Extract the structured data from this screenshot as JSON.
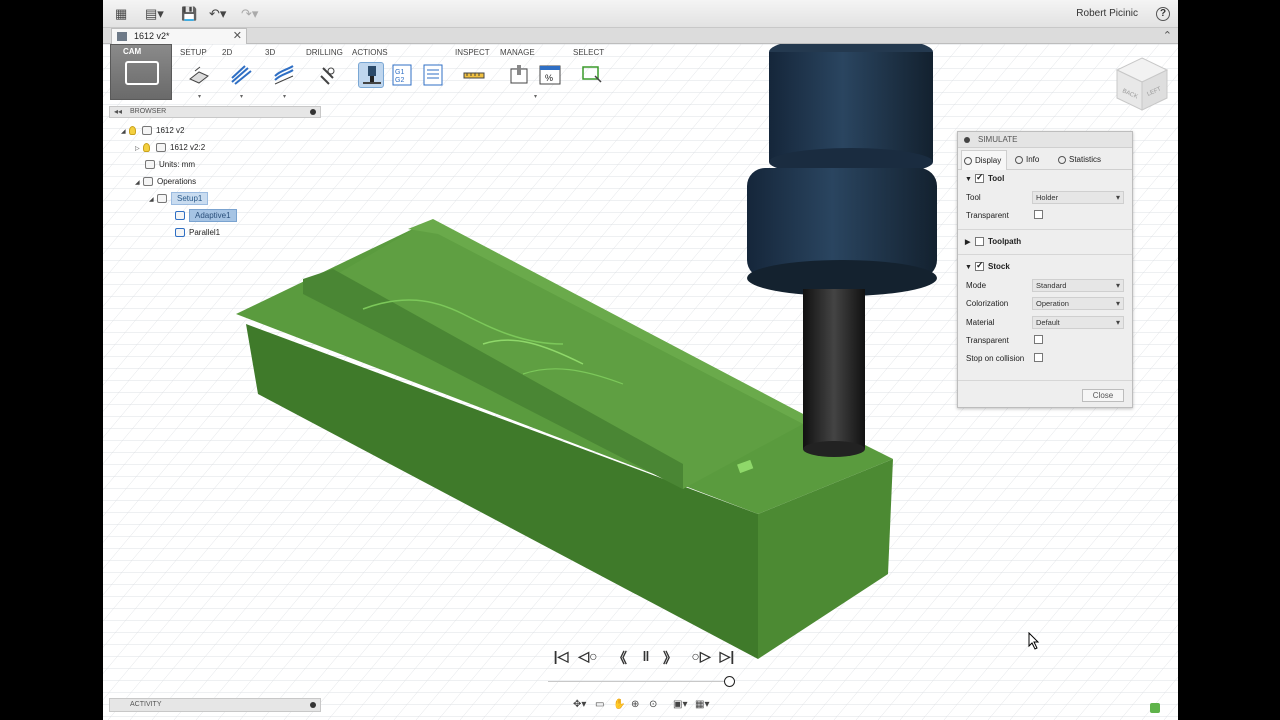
{
  "appbar": {
    "user": "Robert Picinic",
    "help": "?"
  },
  "document_tab": {
    "title": "1612 v2*",
    "close": "✕"
  },
  "ribbon": {
    "workspace": "CAM",
    "groups": [
      "SETUP",
      "2D",
      "3D",
      "DRILLING",
      "ACTIONS",
      "INSPECT",
      "MANAGE",
      "SELECT"
    ]
  },
  "browser": {
    "title": "BROWSER",
    "nodes": [
      {
        "label": "1612 v2"
      },
      {
        "label": "1612 v2:2"
      },
      {
        "label": "Units: mm"
      },
      {
        "label": "Operations"
      },
      {
        "label": "Setup1"
      },
      {
        "label": "Adaptive1"
      },
      {
        "label": "Parallel1"
      }
    ]
  },
  "simulate": {
    "title": "SIMULATE",
    "tabs": [
      "Display",
      "Info",
      "Statistics"
    ],
    "tool_section": {
      "label": "Tool",
      "checked": true,
      "rows": [
        {
          "label": "Tool",
          "value": "Holder"
        },
        {
          "label": "Transparent",
          "checked": false
        }
      ]
    },
    "toolpath_section": {
      "label": "Toolpath",
      "checked": false
    },
    "stock_section": {
      "label": "Stock",
      "checked": true,
      "rows": [
        {
          "label": "Mode",
          "value": "Standard"
        },
        {
          "label": "Colorization",
          "value": "Operation"
        },
        {
          "label": "Material",
          "value": "Default"
        },
        {
          "label": "Transparent",
          "checked": false
        },
        {
          "label": "Stop on collision",
          "checked": false
        }
      ]
    },
    "close_label": "Close"
  },
  "viewcube": {
    "back": "BACK",
    "left": "LEFT"
  },
  "activity": {
    "title": "ACTIVITY"
  },
  "colors": {
    "stock_green": "#4f8f34",
    "holder_navy": "#1c3147",
    "tool_shank": "#2d2d2d",
    "grid": "#dcdfe3",
    "accent_blue": "#7aa7d4"
  }
}
